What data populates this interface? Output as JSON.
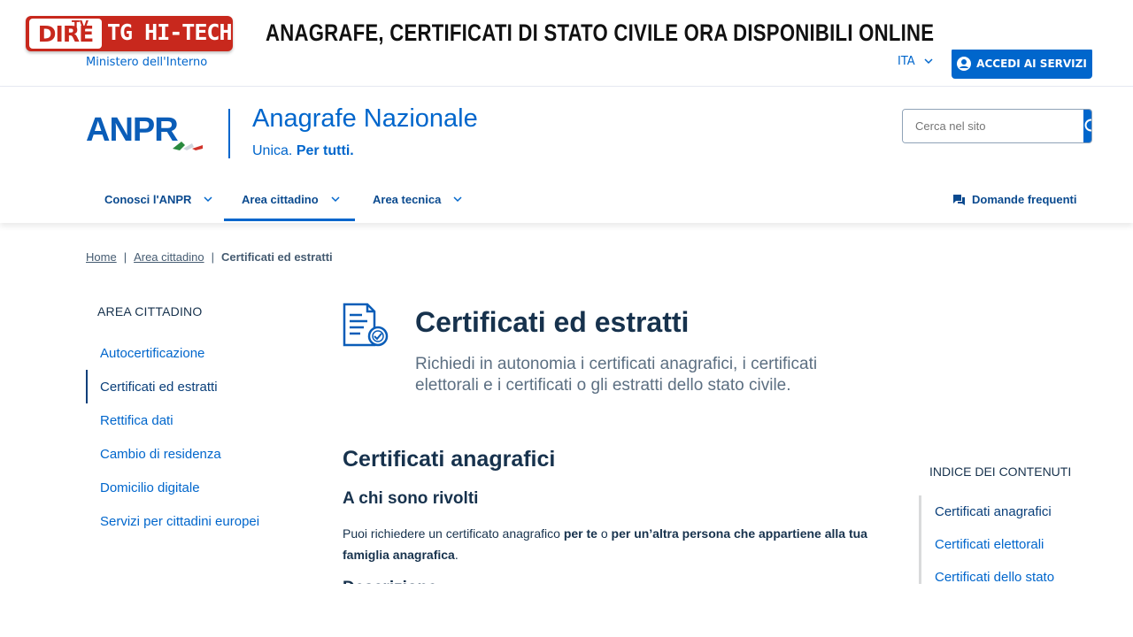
{
  "overlay": {
    "tv": "TV",
    "brand": "DIRE",
    "show": "TG HI-TECH",
    "headline": "ANAGRAFE, CERTIFICATI DI STATO CIVILE ORA DISPONIBILI ONLINE"
  },
  "slim": {
    "ministry": "Ministero dell'Interno",
    "lang": "ITA",
    "login": "ACCEDI AI SERVIZI"
  },
  "header": {
    "logo": "ANPR",
    "title": "Anagrafe Nazionale",
    "tag_plain": "Unica.",
    "tag_bold": "Per tutti.",
    "search_placeholder": "Cerca nel sito"
  },
  "nav": {
    "items": [
      {
        "label": "Conosci l'ANPR"
      },
      {
        "label": "Area cittadino"
      },
      {
        "label": "Area tecnica"
      }
    ],
    "faq": "Domande frequenti"
  },
  "breadcrumb": {
    "home": "Home",
    "section": "Area cittadino",
    "current": "Certificati ed estratti",
    "sep": "|"
  },
  "sidebar": {
    "title": "AREA CITTADINO",
    "items": [
      {
        "label": "Autocertificazione"
      },
      {
        "label": "Certificati ed estratti"
      },
      {
        "label": "Rettifica dati"
      },
      {
        "label": "Cambio di residenza"
      },
      {
        "label": "Domicilio digitale"
      },
      {
        "label": "Servizi per cittadini europei"
      }
    ]
  },
  "main": {
    "title": "Certificati ed estratti",
    "lead": "Richiedi in autonomia i certificati anagrafici, i certificati elettorali e i certificati o gli estratti dello stato civile.",
    "section_title": "Certificati anagrafici",
    "subtitle": "A chi sono rivolti",
    "para_1": "Puoi richiedere un certificato anagrafico ",
    "para_b1": "per te",
    "para_2": " o ",
    "para_b2": "per un’altra persona che appartiene alla tua famiglia anagrafica",
    "para_3": ".",
    "next_heading": "Descrizione"
  },
  "toc": {
    "title": "INDICE DEI CONTENUTI",
    "items": [
      {
        "label": "Certificati anagrafici"
      },
      {
        "label": "Certificati elettorali"
      },
      {
        "label": "Certificati dello stato"
      }
    ]
  },
  "colors": {
    "primary": "#0066cc",
    "text": "#17324d",
    "brand_red": "#c8281d"
  }
}
